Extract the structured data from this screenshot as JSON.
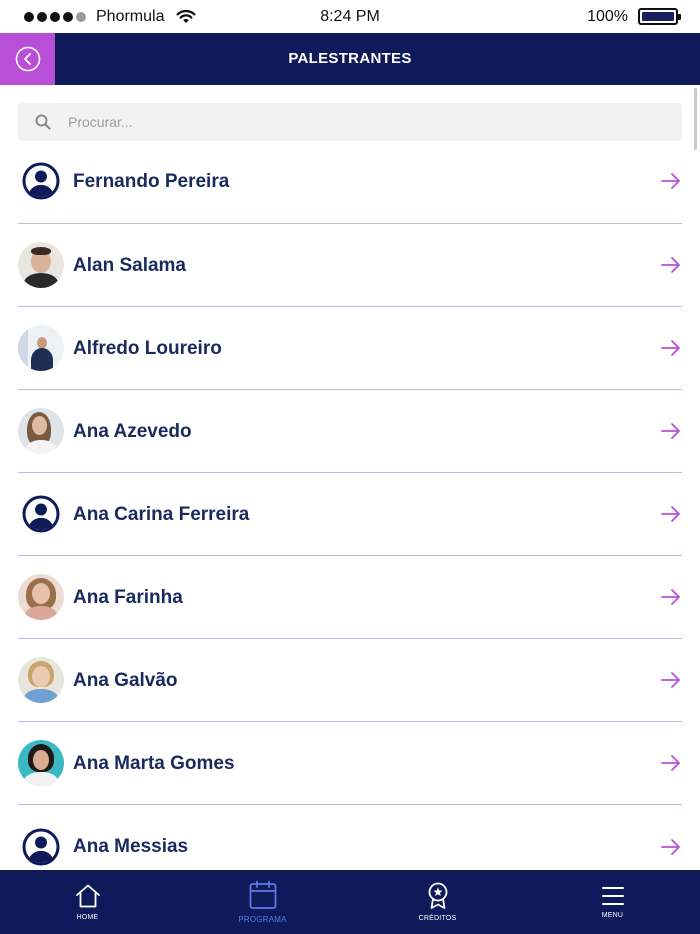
{
  "status_bar": {
    "carrier": "Phormula",
    "time": "8:24 PM",
    "battery": "100%"
  },
  "header": {
    "title": "PALESTRANTES",
    "back_icon": "chevron-left-circle-icon"
  },
  "search": {
    "placeholder": "Procurar..."
  },
  "speakers": [
    {
      "name": "Fernando Pereira",
      "avatar": "user-placeholder-icon"
    },
    {
      "name": "Alan Salama",
      "avatar": "photo"
    },
    {
      "name": "Alfredo Loureiro",
      "avatar": "photo"
    },
    {
      "name": "Ana Azevedo",
      "avatar": "photo"
    },
    {
      "name": "Ana Carina Ferreira",
      "avatar": "user-placeholder-icon"
    },
    {
      "name": "Ana Farinha",
      "avatar": "photo"
    },
    {
      "name": "Ana Galvão",
      "avatar": "photo"
    },
    {
      "name": "Ana Marta Gomes",
      "avatar": "photo"
    },
    {
      "name": "Ana Messias",
      "avatar": "user-placeholder-icon"
    }
  ],
  "tabs": [
    {
      "label": "HOME",
      "icon": "home-icon"
    },
    {
      "label": "PROGRAMA",
      "icon": "calendar-icon",
      "active": true
    },
    {
      "label": "CRÉDITOS",
      "icon": "award-icon"
    },
    {
      "label": "MENU",
      "icon": "hamburger-menu-icon"
    }
  ],
  "colors": {
    "navy": "#0e1a5a",
    "accent_purple": "#b94fd6",
    "name_text": "#1a2a5e",
    "divider": "#b4bfe6",
    "active_tab": "#5b7be6"
  }
}
